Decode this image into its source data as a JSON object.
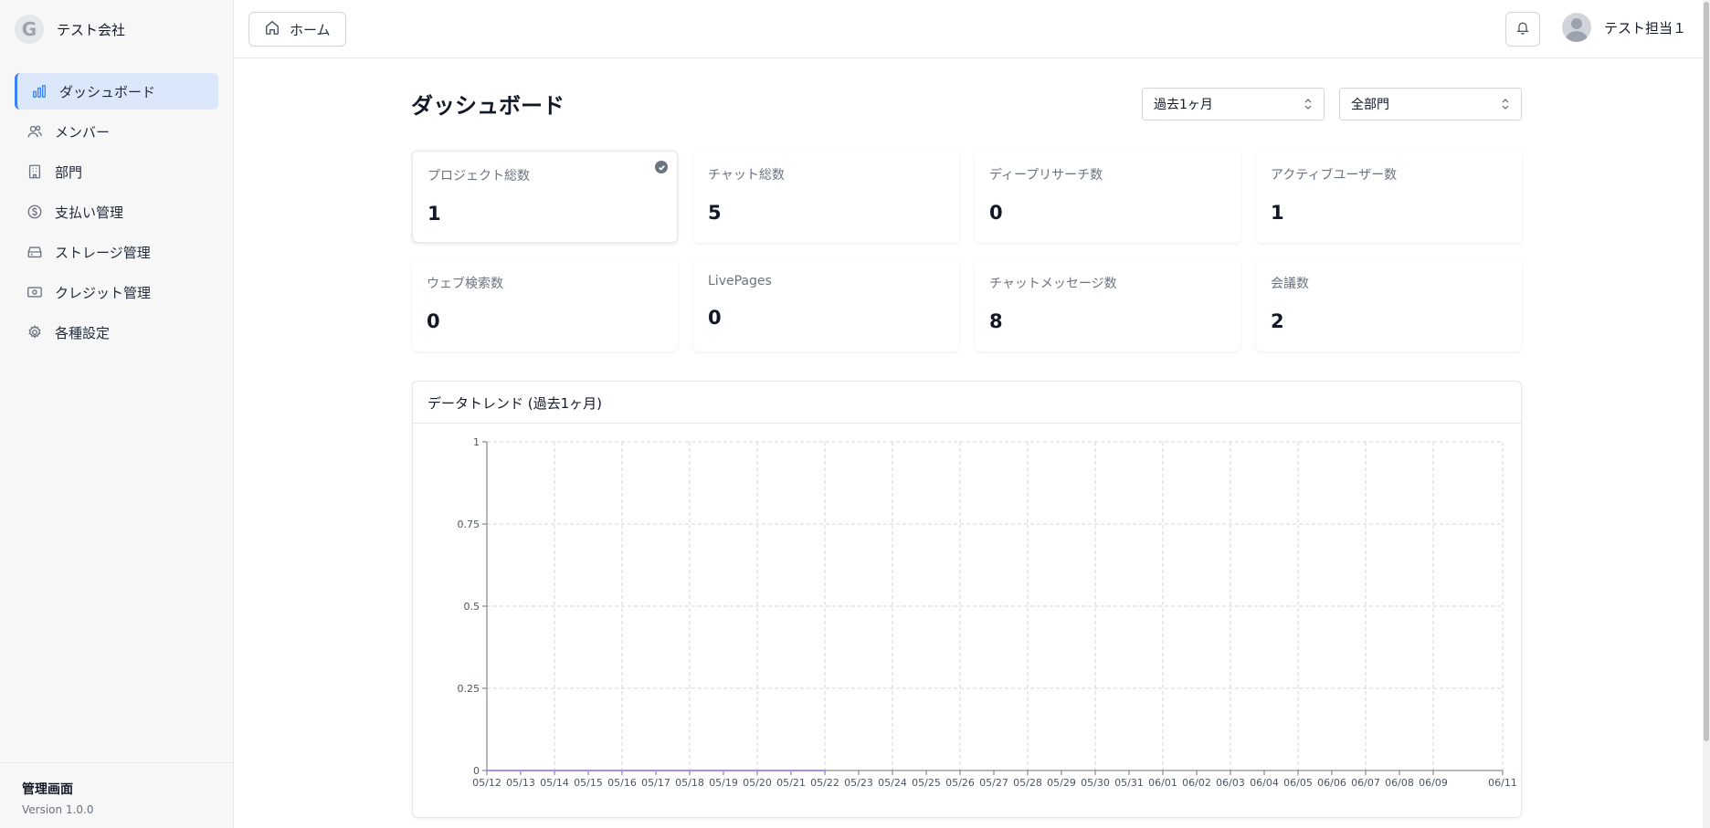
{
  "company": {
    "logo_letter": "G",
    "name": "テスト会社"
  },
  "sidebar": {
    "items": [
      {
        "label": "ダッシュボード",
        "icon": "bar-chart-icon",
        "active": true
      },
      {
        "label": "メンバー",
        "icon": "users-icon",
        "active": false
      },
      {
        "label": "部門",
        "icon": "building-icon",
        "active": false
      },
      {
        "label": "支払い管理",
        "icon": "dollar-circle-icon",
        "active": false
      },
      {
        "label": "ストレージ管理",
        "icon": "storage-icon",
        "active": false
      },
      {
        "label": "クレジット管理",
        "icon": "credit-icon",
        "active": false
      },
      {
        "label": "各種設定",
        "icon": "gear-icon",
        "active": false
      }
    ],
    "footer": {
      "title": "管理画面",
      "version": "Version 1.0.0"
    }
  },
  "header": {
    "home_label": "ホーム",
    "user_name": "テスト担当１"
  },
  "main": {
    "title": "ダッシュボード",
    "period_select": "過去1ヶ月",
    "department_select": "全部門",
    "stats": [
      {
        "label": "プロジェクト総数",
        "value": "1",
        "selected": true
      },
      {
        "label": "チャット総数",
        "value": "5"
      },
      {
        "label": "ディープリサーチ数",
        "value": "0"
      },
      {
        "label": "アクティブユーザー数",
        "value": "1"
      },
      {
        "label": "ウェブ検索数",
        "value": "0"
      },
      {
        "label": "LivePages",
        "value": "0"
      },
      {
        "label": "チャットメッセージ数",
        "value": "8"
      },
      {
        "label": "会議数",
        "value": "2"
      }
    ],
    "chart_title": "データトレンド (過去1ヶ月)"
  },
  "colors": {
    "accent": "#3b82f6",
    "active_bg": "#dbe7fb",
    "series": "#a78bfa"
  },
  "chart_data": {
    "type": "line",
    "title": "データトレンド (過去1ヶ月)",
    "x": [
      "05/12",
      "05/13",
      "05/14",
      "05/15",
      "05/16",
      "05/17",
      "05/18",
      "05/19",
      "05/20",
      "05/21",
      "05/22",
      "05/23",
      "05/24",
      "05/25",
      "05/26",
      "05/27",
      "05/28",
      "05/29",
      "05/30",
      "05/31",
      "06/01",
      "06/02",
      "06/03",
      "06/04",
      "06/05",
      "06/06",
      "06/07",
      "06/08",
      "06/09",
      "06/11"
    ],
    "yticks": [
      "0",
      "0.25",
      "0.5",
      "0.75",
      "1"
    ],
    "ylim": [
      0,
      1
    ],
    "series": [
      {
        "values": [
          0,
          0,
          0,
          0,
          0,
          0,
          0,
          0,
          0,
          0,
          0
        ],
        "color": "#a78bfa"
      }
    ],
    "grid": true,
    "xlabel": "",
    "ylabel": ""
  }
}
